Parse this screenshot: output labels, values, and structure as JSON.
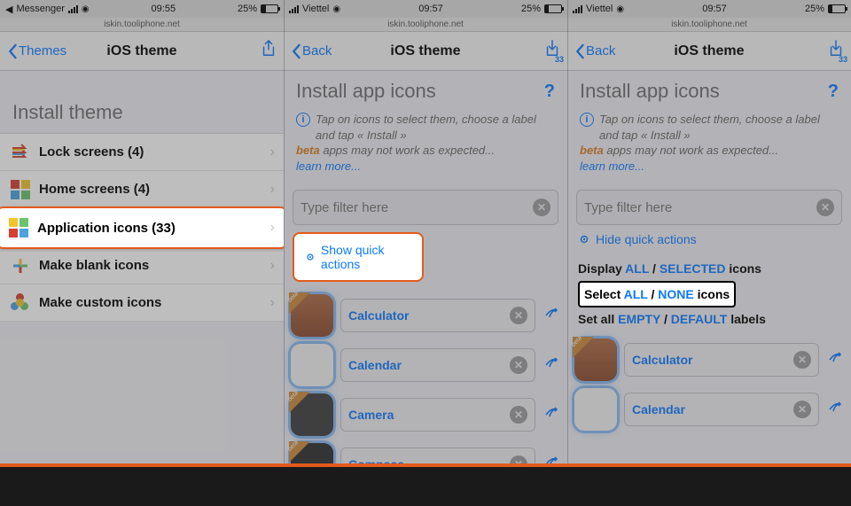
{
  "status": {
    "back_app": "Messenger",
    "carrier": "Viettel",
    "time": "09:55",
    "time2": "09:57",
    "battery": "25%"
  },
  "url": "iskin.tooliphone.net",
  "nav": {
    "back_themes": "Themes",
    "back": "Back",
    "title": "iOS theme",
    "badge": "33"
  },
  "p1": {
    "section": "Install theme",
    "rows": [
      {
        "label": "Lock screens (4)"
      },
      {
        "label": "Home screens (4)"
      },
      {
        "label": "Application icons (33)"
      },
      {
        "label": "Make blank icons"
      },
      {
        "label": "Make custom icons"
      }
    ]
  },
  "content": {
    "heading": "Install app icons",
    "help": "?",
    "tip": "Tap on icons to select them, choose a label and tap « Install »",
    "beta": "beta",
    "beta_rest": " apps may not work as expected...",
    "learn": "learn more...",
    "filter_ph": "Type filter here",
    "qa_show": "Show quick actions",
    "qa_hide": "Hide quick actions",
    "disp_pre": "Display ",
    "all": "ALL",
    "sep": " / ",
    "selected": "SELECTED",
    "disp_post": " icons",
    "sel_pre": "Select ",
    "none": "NONE",
    "sel_post": " icons",
    "setall_pre": "Set all ",
    "empty": "EMPTY",
    "default": "DEFAULT",
    "setall_post": " labels"
  },
  "apps": {
    "calc": "Calculator",
    "cal": "Calendar",
    "cam": "Camera",
    "comp": "Compass"
  }
}
